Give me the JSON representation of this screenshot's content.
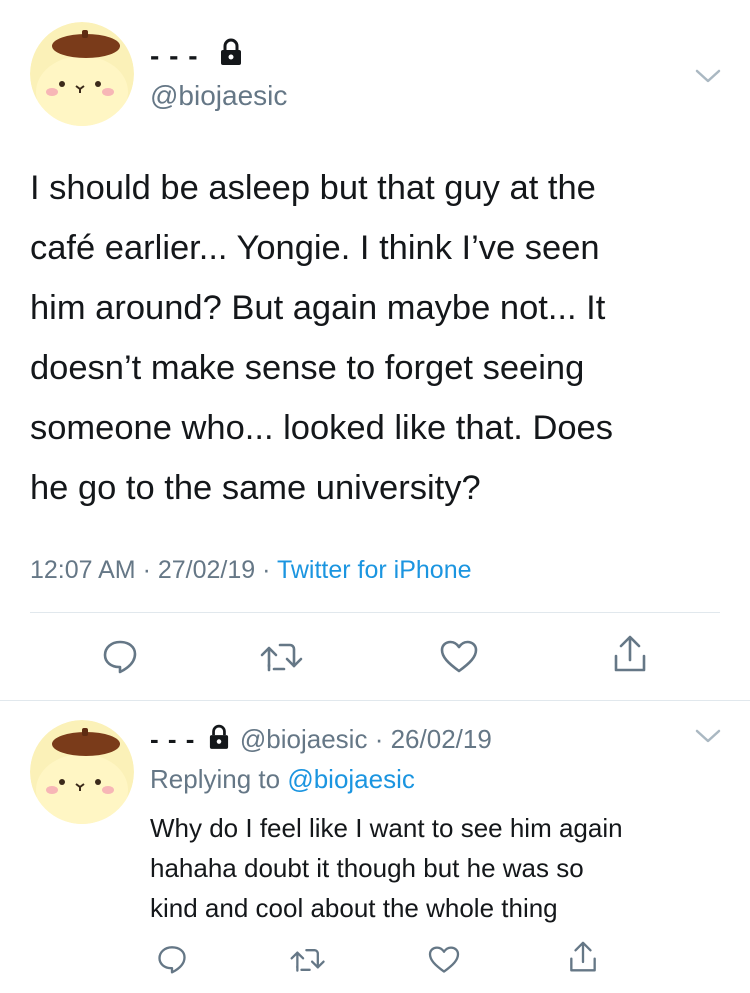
{
  "tweet": {
    "author_name": "- - -",
    "author_handle": "@biojaesic",
    "text_lines": [
      "I should be asleep but that guy at the",
      "café earlier... Yongie. I think I’ve seen",
      "him around? But again maybe not... It",
      "doesn’t make sense to forget seeing",
      "someone who... looked like that. Does",
      "he go to the same university?"
    ],
    "time": "12:07 AM",
    "date": "27/02/19",
    "separator": "·",
    "source": "Twitter for iPhone"
  },
  "reply": {
    "author_name": "- - -",
    "author_handle": "@biojaesic",
    "date": "26/02/19",
    "separator": "·",
    "replying_prefix": "Replying to",
    "replying_to": "@biojaesic",
    "text_lines": [
      "Why do I feel like I want to see him again",
      "hahaha doubt it though but he was so",
      "kind and cool about the whole thing"
    ]
  },
  "icons": {
    "lock": "lock-icon",
    "chevron": "chevron-down-icon",
    "reply": "reply-icon",
    "retweet": "retweet-icon",
    "like": "heart-icon",
    "share": "share-icon"
  },
  "colors": {
    "text": "#14171a",
    "secondary": "#657786",
    "link": "#1b95e0",
    "divider": "#e1e8ed",
    "avatar_face": "#fff3b0",
    "avatar_beret": "#7a3b1a"
  }
}
